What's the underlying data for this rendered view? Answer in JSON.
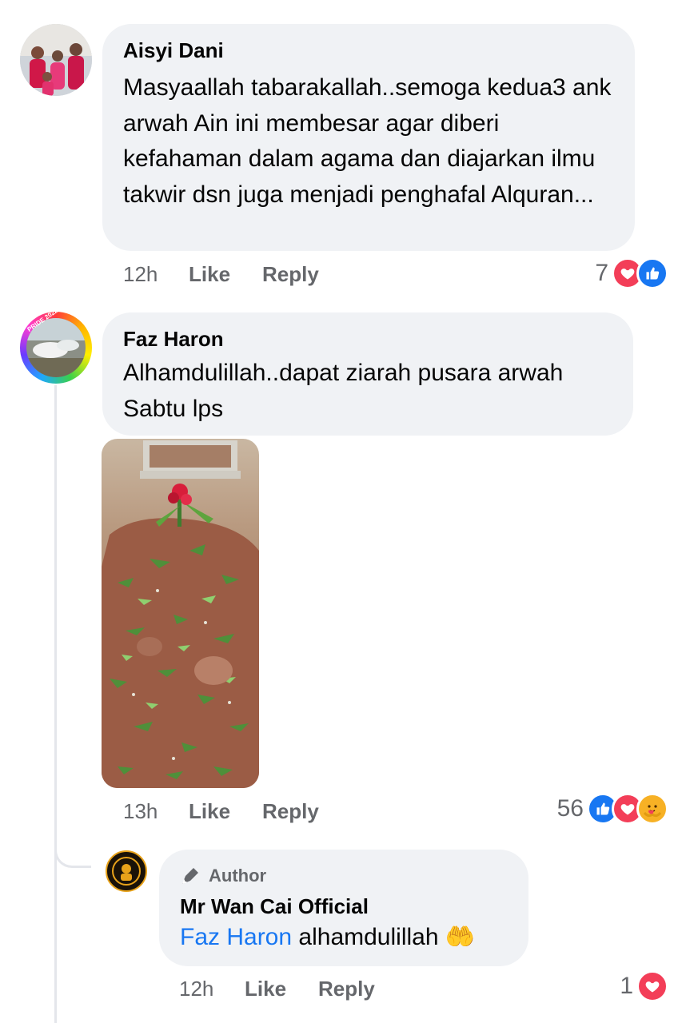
{
  "colors": {
    "bubble": "#f0f2f5",
    "meta_text": "#65676b",
    "like_blue": "#1877f2",
    "love_red": "#f33e58",
    "care_yellow": "#f7b125",
    "mention_blue": "#1877f2"
  },
  "comments": [
    {
      "author": "Aisyi Dani",
      "text": "Masyaallah tabarakallah..semoga kedua3 ank arwah Ain ini membesar agar diberi kefahaman dalam agama dan diajarkan ilmu takwir dsn juga menjadi penghafal Alquran...",
      "time": "12h",
      "like_label": "Like",
      "reply_label": "Reply",
      "reaction_count": "7",
      "reaction_icons": [
        "love-icon",
        "like-icon"
      ]
    },
    {
      "author": "Faz Haron",
      "text": "Alhamdulillah..dapat ziarah pusara arwah Sabtu lps",
      "time": "13h",
      "like_label": "Like",
      "reply_label": "Reply",
      "reaction_count": "56",
      "reaction_icons": [
        "like-icon",
        "love-icon",
        "care-icon"
      ],
      "avatar_badge_text": "PRIDE 2022",
      "reply": {
        "badge": "Author",
        "author": "Mr Wan Cai Official",
        "mention": "Faz Haron",
        "text": "alhamdulillah",
        "emoji": "🤲",
        "time": "12h",
        "like_label": "Like",
        "reply_label": "Reply",
        "reaction_count": "1",
        "reaction_icons": [
          "love-icon"
        ]
      }
    }
  ]
}
